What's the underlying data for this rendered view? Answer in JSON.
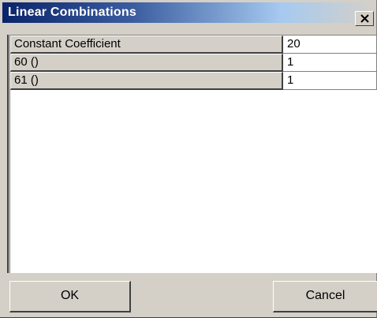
{
  "window": {
    "title": "Linear Combinations"
  },
  "grid": {
    "rows": [
      {
        "label": "Constant Coefficient",
        "value": "20"
      },
      {
        "label": "60 ()",
        "value": "1"
      },
      {
        "label": "61 ()",
        "value": "1"
      }
    ]
  },
  "buttons": {
    "ok_label": "OK",
    "cancel_label": "Cancel"
  },
  "icons": {
    "close": "close-icon"
  },
  "colors": {
    "titlebar_start": "#0a246a",
    "dialog_face": "#d4d0c8"
  }
}
